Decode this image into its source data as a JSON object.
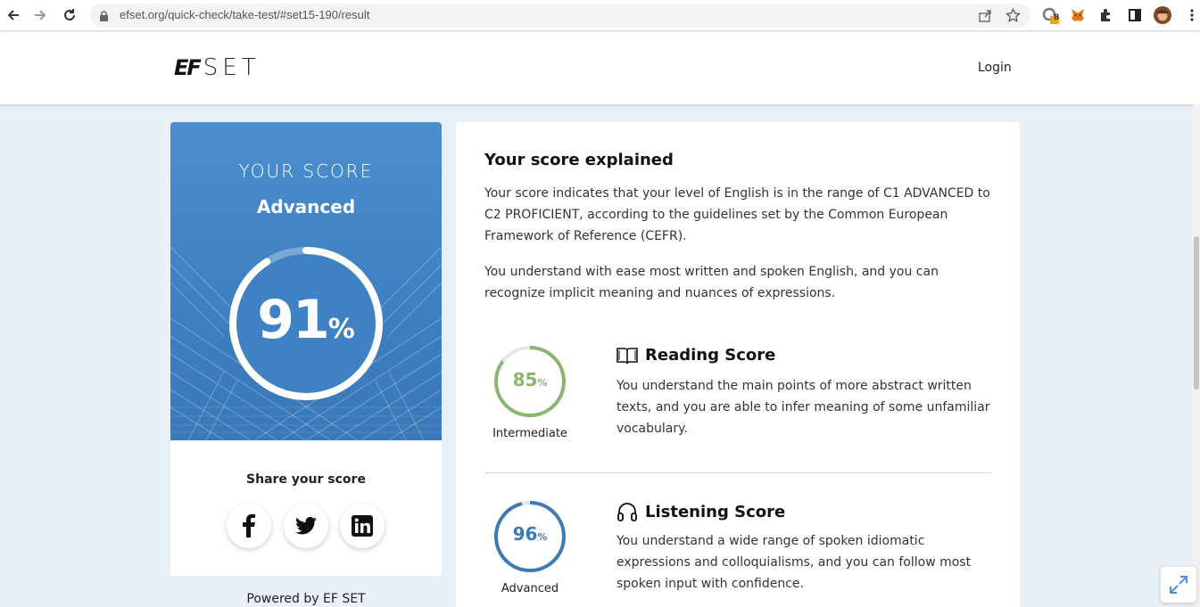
{
  "browser": {
    "url": "efset.org/quick-check/take-test/#set15-190/result",
    "extension_badge": "8"
  },
  "header": {
    "logo_ef": "EF",
    "logo_set": "SET",
    "login_label": "Login"
  },
  "score_card": {
    "heading": "YOUR SCORE",
    "level": "Advanced",
    "score": "91",
    "score_unit": "%",
    "share_title": "Share your score",
    "share_buttons": [
      "facebook-icon",
      "twitter-icon",
      "linkedin-icon"
    ],
    "powered_by": "Powered by EF SET"
  },
  "explanation": {
    "title": "Your score explained",
    "paragraph1": "Your score indicates that your level of English is in the range of C1 ADVANCED to C2 PROFICIENT, according to the guidelines set by the Common European Framework of Reference (CEFR).",
    "paragraph2": "You understand with ease most written and spoken English, and you can recognize implicit meaning and nuances of expressions.",
    "sections": [
      {
        "title": "Reading Score",
        "icon": "book-icon",
        "score": "85",
        "unit": "%",
        "level": "Intermediate",
        "color": "#8ab56e",
        "description": "You understand the main points of more abstract written texts, and you are able to infer meaning of some unfamiliar vocabulary."
      },
      {
        "title": "Listening Score",
        "icon": "headphones-icon",
        "score": "96",
        "unit": "%",
        "level": "Advanced",
        "color": "#3d7ab5",
        "description": "You understand a wide range of spoken idiomatic expressions and colloquialisms, and you can follow most spoken input with confidence."
      }
    ]
  },
  "colors": {
    "score_blue": "#4b8fce",
    "reading_green": "#8ab56e",
    "listening_blue": "#3d7ab5",
    "page_bg": "#e9f0f8"
  }
}
